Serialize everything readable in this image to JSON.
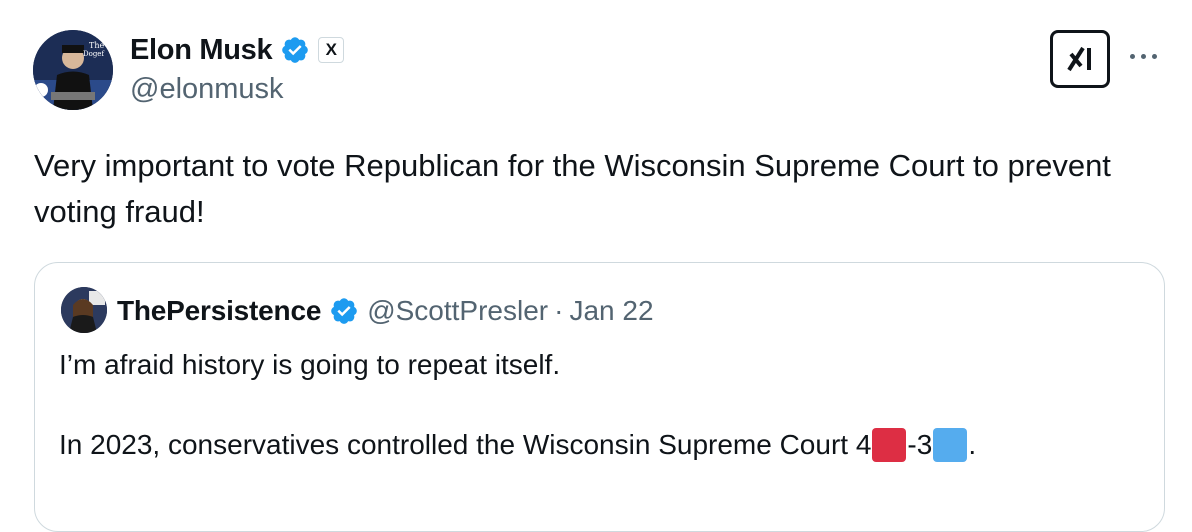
{
  "author": {
    "display_name": "Elon Musk",
    "handle": "@elonmusk",
    "affiliation_badge": "X",
    "verified_color": "#1d9bf0"
  },
  "header_actions": {
    "grok_icon": "grok-icon",
    "more_icon": "more-icon"
  },
  "tweet": {
    "text": "Very important to vote Republican for the Wisconsin Supreme Court to prevent voting fraud!"
  },
  "quoted": {
    "display_name": "ThePersistence",
    "handle": "@ScottPresler",
    "separator": "·",
    "date": "Jan 22",
    "line1": "I’m afraid history is going to repeat itself.",
    "line2_prefix": "In 2023, conservatives controlled the Wisconsin Supreme Court 4",
    "line2_middle": "-3",
    "line2_suffix": ".",
    "red_square_color": "#dd2e44",
    "blue_square_color": "#55acee"
  }
}
